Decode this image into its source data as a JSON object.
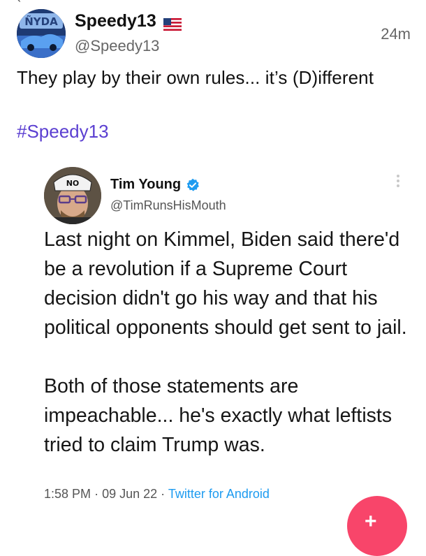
{
  "post": {
    "author_name": "Speedy13",
    "author_handle": "@Speedy13",
    "time_ago": "24m",
    "text": "They play by their own rules... it’s (D)ifferent",
    "hashtag": "#Speedy13",
    "flag_icon": "us-flag-icon",
    "avatar_text": "ÑYDA"
  },
  "embedded_tweet": {
    "name": "Tim Young",
    "handle": "@TimRunsHisMouth",
    "verified_icon": "verified-badge-icon",
    "verified_color": "#1d9bf0",
    "avatar_cap_text": "NO",
    "paragraph_1": "Last night on Kimmel, Biden said there'd be a revolution if a Supreme Court decision didn't go his way and that his political opponents should get sent to jail.",
    "paragraph_2": "Both of those statements are impeachable... he's exactly what leftists tried to claim Trump was.",
    "time": "1:58 PM",
    "date": "09 Jun 22",
    "separator": "·",
    "source": "Twitter for Android"
  },
  "colors": {
    "hashtag": "#5b3fd1",
    "link": "#1d9bf0",
    "fab": "#f8456a"
  },
  "fab": {
    "icon": "plus-icon"
  }
}
